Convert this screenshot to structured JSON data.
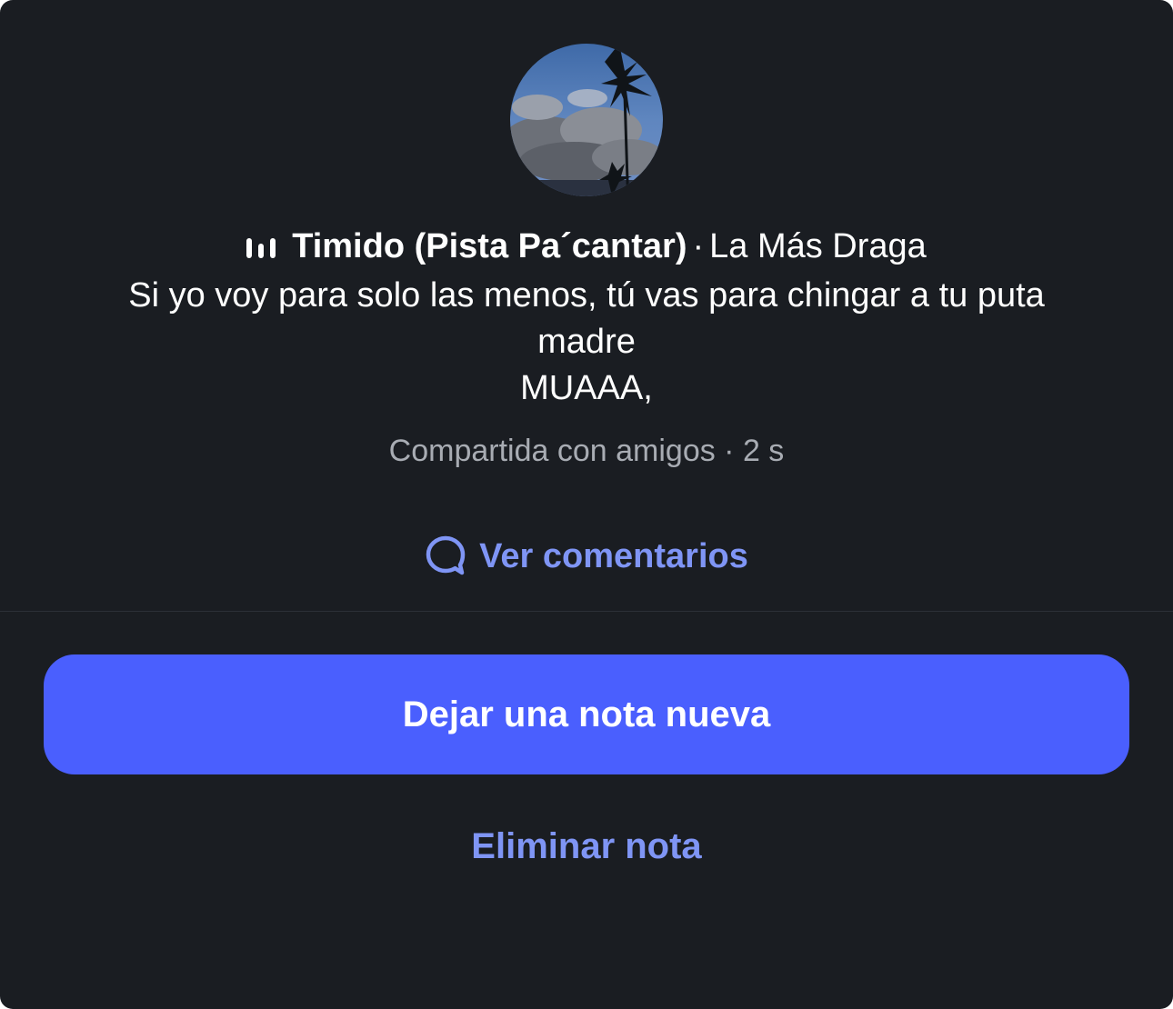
{
  "note": {
    "music": {
      "icon": "music-bars-icon",
      "title": "Timido (Pista Pa´cantar)",
      "separator": "·",
      "artist": "La Más Draga"
    },
    "text": "Si yo voy para solo las menos, tú vas para chingar a tu puta madre\nMUAAA,",
    "meta": "Compartida con amigos · 2 s"
  },
  "actions": {
    "comments_icon": "speech-bubble-icon",
    "comments_label": "Ver comentarios",
    "new_note_label": "Dejar una nota nueva",
    "delete_label": "Eliminar nota"
  },
  "colors": {
    "background": "#1a1d22",
    "accent_link": "#7f95f5",
    "primary_button": "#4a5ffe",
    "muted_text": "#a8acb3"
  }
}
